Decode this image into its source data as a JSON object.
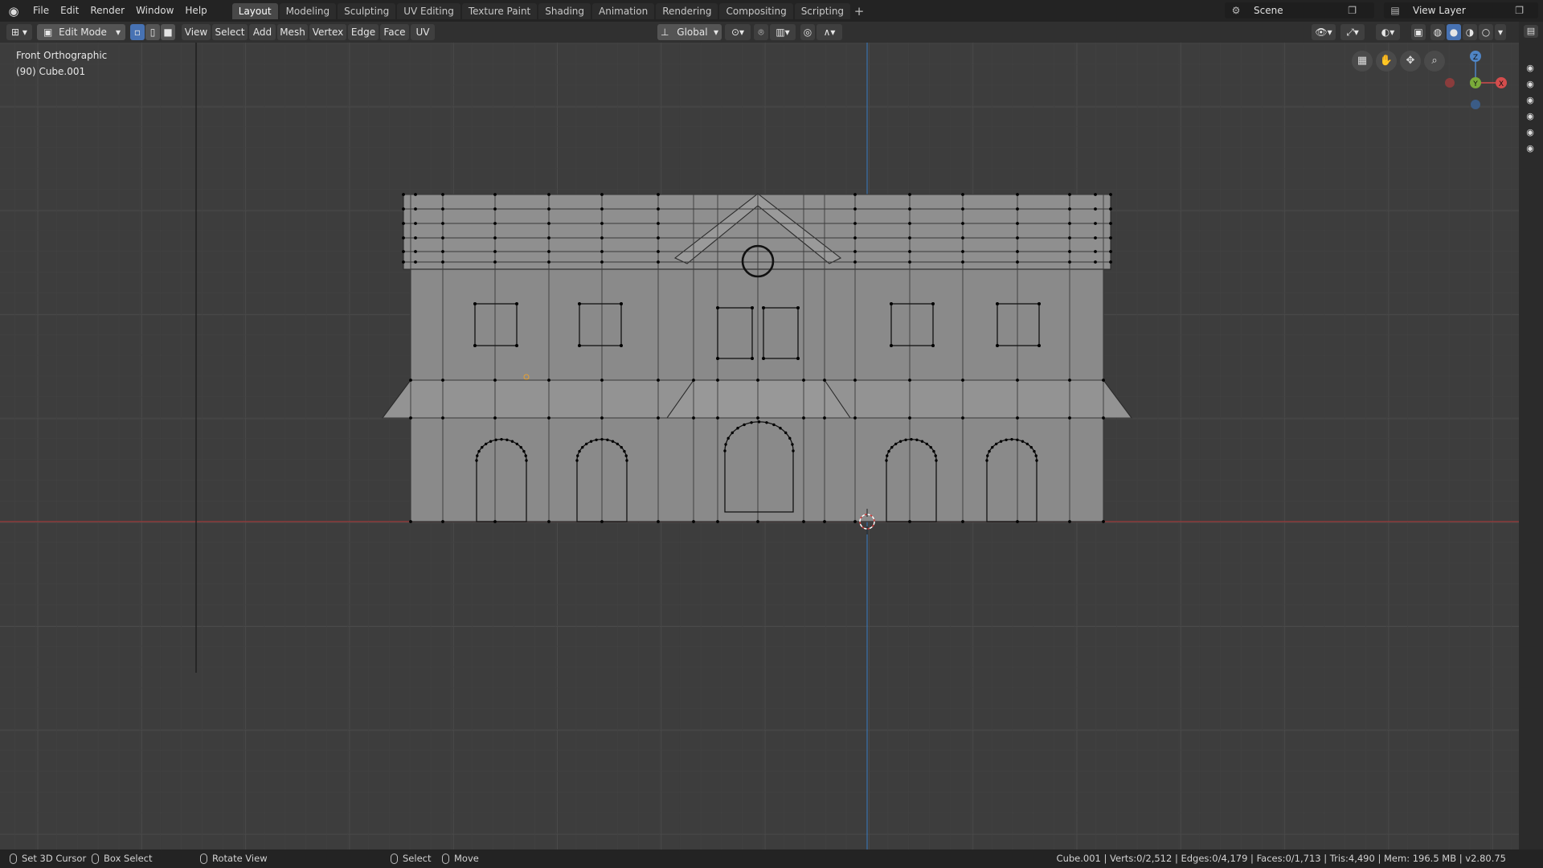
{
  "topbar": {
    "menus": [
      "File",
      "Edit",
      "Render",
      "Window",
      "Help"
    ],
    "workspace_tabs": [
      "Layout",
      "Modeling",
      "Sculpting",
      "UV Editing",
      "Texture Paint",
      "Shading",
      "Animation",
      "Rendering",
      "Compositing",
      "Scripting"
    ],
    "active_tab": "Layout",
    "add_tab_symbol": "+",
    "scene": "Scene",
    "view_layer": "View Layer"
  },
  "header": {
    "mode": "Edit Mode",
    "menus": [
      "View",
      "Select",
      "Add",
      "Mesh",
      "Vertex",
      "Edge",
      "Face",
      "UV"
    ],
    "transform_orientation": "Global"
  },
  "viewport": {
    "view_name": "Front Orthographic",
    "object_label": "(90) Cube.001",
    "gizmo": {
      "z": "Z",
      "y": "Y",
      "x": "X"
    },
    "colors": {
      "background": "#3d3d3d",
      "mesh_face": "#8a8a8a",
      "x_axis": "#9b3a3a",
      "z_axis": "#3a6ea5"
    }
  },
  "statusbar": {
    "left": [
      {
        "icon": "mouse-left-icon",
        "label": "Set 3D Cursor"
      },
      {
        "icon": "mouse-right-icon",
        "label": "Box Select"
      },
      {
        "icon": "mouse-middle-icon",
        "label": "Rotate View"
      },
      {
        "icon": "mouse-left-icon",
        "label": "Select"
      },
      {
        "icon": "mouse-right-icon",
        "label": "Move"
      }
    ],
    "stats": "Cube.001 | Verts:0/2,512 | Edges:0/4,179 | Faces:0/1,713 | Tris:4,490 | Mem: 196.5 MB | v2.80.75"
  }
}
